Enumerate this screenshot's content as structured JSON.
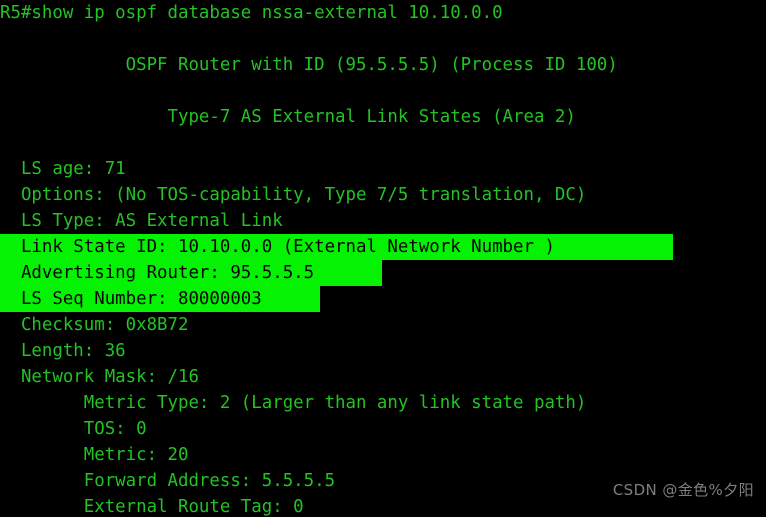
{
  "terminal": {
    "background_color": "#000000",
    "text_color": "#22c322",
    "highlight_background_color": "#05f205",
    "highlight_text_color": "#050505",
    "prompt_line": "R5#show ip ospf database nssa-external 10.10.0.0",
    "header": {
      "router_line": "            OSPF Router with ID (95.5.5.5) (Process ID 100)",
      "section_line": "                Type-7 AS External Link States (Area 2)"
    },
    "lsa_lines": [
      {
        "text": "  LS age: 71",
        "highlighted": false
      },
      {
        "text": "  Options: (No TOS-capability, Type 7/5 translation, DC)",
        "highlighted": false
      },
      {
        "text": "  LS Type: AS External Link",
        "highlighted": false
      },
      {
        "text": "  Link State ID: 10.10.0.0 (External Network Number )",
        "highlighted": true,
        "highlight_width": 673
      },
      {
        "text": "  Advertising Router: 95.5.5.5",
        "highlighted": true,
        "highlight_width": 382
      },
      {
        "text": "  LS Seq Number: 80000003",
        "highlighted": true,
        "highlight_width": 320
      },
      {
        "text": "  Checksum: 0x8B72",
        "highlighted": false
      },
      {
        "text": "  Length: 36",
        "highlighted": false
      },
      {
        "text": "  Network Mask: /16",
        "highlighted": false
      },
      {
        "text": "        Metric Type: 2 (Larger than any link state path)",
        "highlighted": false
      },
      {
        "text": "        TOS: 0",
        "highlighted": false
      },
      {
        "text": "        Metric: 20",
        "highlighted": false
      },
      {
        "text": "        Forward Address: 5.5.5.5",
        "highlighted": false
      },
      {
        "text": "        External Route Tag: 0",
        "highlighted": false
      }
    ],
    "watermark": "CSDN @金色%夕阳"
  }
}
